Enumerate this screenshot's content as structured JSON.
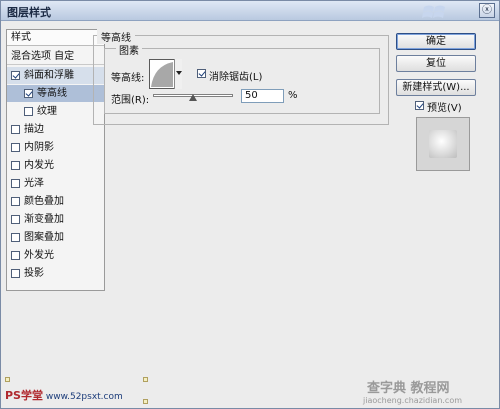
{
  "window": {
    "title": "图层样式",
    "close_label": "ⓧ"
  },
  "styles_panel": {
    "header": "样式",
    "blend_options": "混合选项 自定",
    "items": [
      {
        "label": "斜面和浮雕",
        "checked": true,
        "indent": 0,
        "state": "parent"
      },
      {
        "label": "等高线",
        "checked": true,
        "indent": 1,
        "state": "selected"
      },
      {
        "label": "纹理",
        "checked": false,
        "indent": 1,
        "state": "normal"
      },
      {
        "label": "描边",
        "checked": false,
        "indent": 0,
        "state": "normal"
      },
      {
        "label": "内阴影",
        "checked": false,
        "indent": 0,
        "state": "normal"
      },
      {
        "label": "内发光",
        "checked": false,
        "indent": 0,
        "state": "normal"
      },
      {
        "label": "光泽",
        "checked": false,
        "indent": 0,
        "state": "normal"
      },
      {
        "label": "颜色叠加",
        "checked": false,
        "indent": 0,
        "state": "normal"
      },
      {
        "label": "渐变叠加",
        "checked": false,
        "indent": 0,
        "state": "normal"
      },
      {
        "label": "图案叠加",
        "checked": false,
        "indent": 0,
        "state": "normal"
      },
      {
        "label": "外发光",
        "checked": false,
        "indent": 0,
        "state": "normal"
      },
      {
        "label": "投影",
        "checked": false,
        "indent": 0,
        "state": "normal"
      }
    ]
  },
  "contour_section": {
    "title": "等高线",
    "group_title": "图素",
    "contour_label": "等高线:",
    "anti_alias_label": "消除锯齿(L)",
    "anti_alias_checked": true,
    "range_label": "范围(R):",
    "range_value": "50",
    "range_unit": "%",
    "range_fraction": 0.5
  },
  "buttons": {
    "ok": "确定",
    "reset": "复位",
    "new_style": "新建样式(W)...",
    "preview_label": "预览(V)",
    "preview_checked": true
  },
  "watermarks": {
    "left_ps": "PS学堂",
    "left_site": "www.52psxt.com",
    "right_main": "查字典 教程网",
    "right_sub": "jiaocheng.chazidian.com"
  },
  "colors": {
    "selected_row": "#aebfd8",
    "title_bar": "#b9c9e0"
  }
}
